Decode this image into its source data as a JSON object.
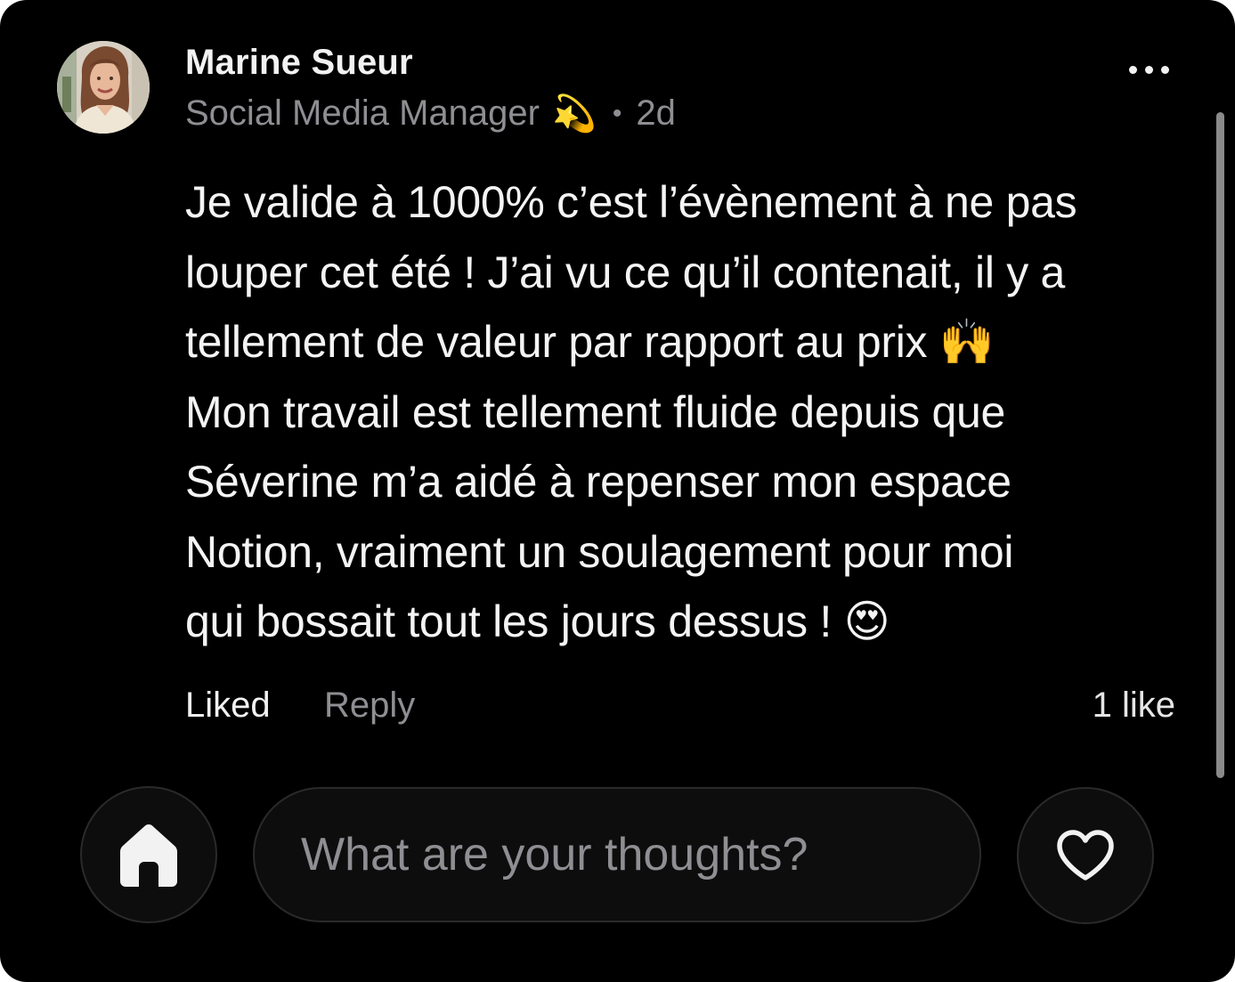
{
  "comment": {
    "author": {
      "name": "Marine Sueur",
      "title": "Social Media Manager",
      "title_emoji": "💫",
      "separator": "•",
      "age": "2d"
    },
    "body_lines": [
      "Je valide à 1000% c’est l’évènement à ne pas",
      "louper cet été ! J’ai vu ce qu’il contenait, il y a",
      "tellement de valeur par rapport au prix 🙌",
      "Mon travail est tellement fluide depuis que",
      "Séverine m’a aidé à repenser mon espace",
      "Notion, vraiment un soulagement pour moi",
      "qui bossait tout les jours dessus ! 😍"
    ],
    "actions": {
      "liked_label": "Liked",
      "reply_label": "Reply",
      "likes_count": "1 like"
    }
  },
  "bottom_bar": {
    "home_icon": "home-icon",
    "input_placeholder": "What are your thoughts?",
    "input_value": "",
    "like_icon": "heart-outline-icon"
  },
  "colors": {
    "background": "#000000",
    "primary_text": "#f2f2f2",
    "secondary_text": "#8e8e93",
    "control_fill": "#0d0d0d",
    "control_border": "#2a2a2a"
  }
}
